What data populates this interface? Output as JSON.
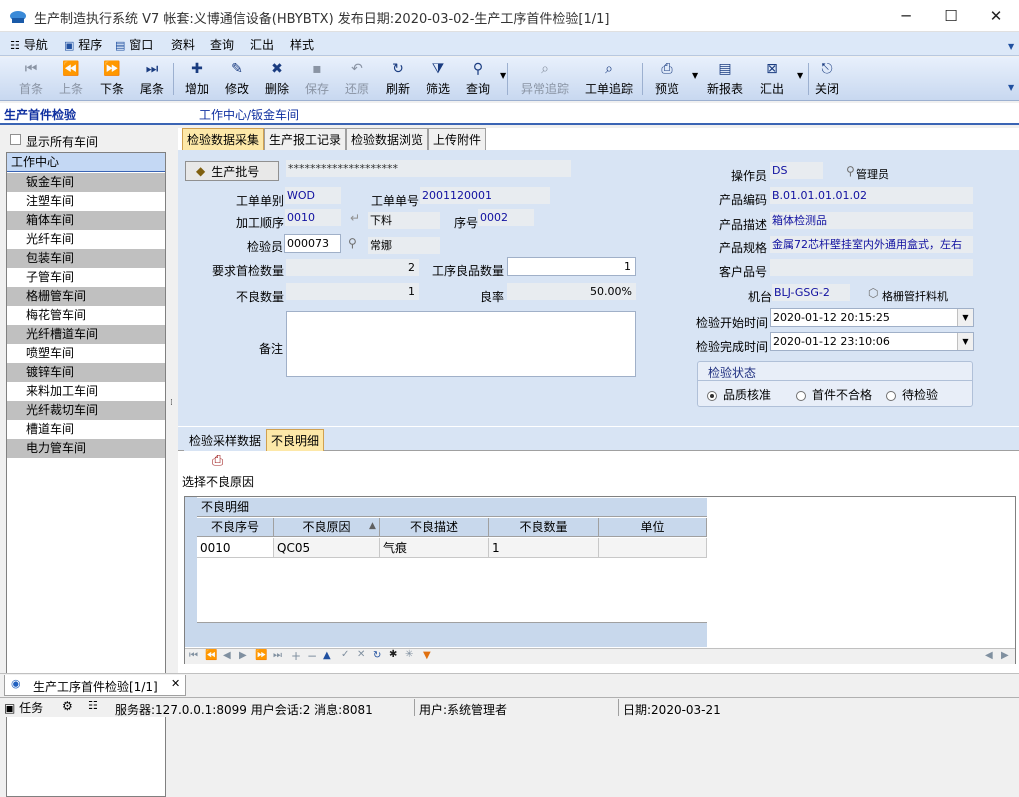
{
  "window": {
    "title": "生产制造执行系统 V7 帐套:义博通信设备(HBYBTX) 发布日期:2020-03-02-生产工序首件检验[1/1]"
  },
  "menu": [
    "导航",
    "程序",
    "窗口",
    "资料",
    "查询",
    "汇出",
    "样式"
  ],
  "toolbar": [
    {
      "label": "首条",
      "icon": "first-icon",
      "enabled": false
    },
    {
      "label": "上条",
      "icon": "prev-icon",
      "enabled": false
    },
    {
      "label": "下条",
      "icon": "next-icon",
      "enabled": true
    },
    {
      "label": "尾条",
      "icon": "last-icon",
      "enabled": true
    },
    {
      "label": "增加",
      "icon": "add-icon",
      "enabled": true
    },
    {
      "label": "修改",
      "icon": "edit-icon",
      "enabled": true
    },
    {
      "label": "删除",
      "icon": "delete-icon",
      "enabled": true
    },
    {
      "label": "保存",
      "icon": "save-icon",
      "enabled": false
    },
    {
      "label": "还原",
      "icon": "undo-icon",
      "enabled": false
    },
    {
      "label": "刷新",
      "icon": "refresh-icon",
      "enabled": true
    },
    {
      "label": "筛选",
      "icon": "filter-icon",
      "enabled": true
    },
    {
      "label": "查询",
      "icon": "query-icon",
      "enabled": true
    },
    {
      "label": "异常追踪",
      "icon": "trace-icon",
      "enabled": false
    },
    {
      "label": "工单追踪",
      "icon": "trace-icon",
      "enabled": true
    },
    {
      "label": "预览",
      "icon": "print-icon",
      "enabled": true
    },
    {
      "label": "新报表",
      "icon": "report-icon",
      "enabled": true
    },
    {
      "label": "汇出",
      "icon": "export-icon",
      "enabled": true
    },
    {
      "label": "关闭",
      "icon": "close-door-icon",
      "enabled": true
    }
  ],
  "module": {
    "title": "生产首件检验",
    "workcenter": "工作中心/钣金车间"
  },
  "left": {
    "show_all": "显示所有车间",
    "header": "工作中心",
    "items": [
      "钣金车间",
      "注塑车间",
      "箱体车间",
      "光纤车间",
      "包装车间",
      "子管车间",
      "格栅管车间",
      "梅花管车间",
      "光纤槽道车间",
      "喷塑车间",
      "镀锌车间",
      "来料加工车间",
      "光纤裁切车间",
      "槽道车间",
      "电力管车间"
    ]
  },
  "tabs": [
    "检验数据采集",
    "生产报工记录",
    "检验数据浏览",
    "上传附件"
  ],
  "form": {
    "batch_button": "生产批号",
    "batch_value": "********************",
    "wo_type_label": "工单单别",
    "wo_type": "WOD",
    "wo_no_label": "工单单号",
    "wo_no": "2001120001",
    "seq_label": "加工顺序",
    "seq": "0010",
    "proc_name": "下料",
    "serial_label": "序号",
    "serial": "0002",
    "inspector_label": "检验员",
    "inspector": "000073",
    "inspector_name": "常娜",
    "req_qty_label": "要求首检数量",
    "req_qty": "2",
    "good_qty_label": "工序良品数量",
    "good_qty": "1",
    "bad_qty_label": "不良数量",
    "bad_qty": "1",
    "yield_label": "良率",
    "yield": "50.00%",
    "remark_label": "备注",
    "operator_label": "操作员",
    "operator": "DS",
    "operator_name": "管理员",
    "prod_code_label": "产品编码",
    "prod_code": "B.01.01.01.01.02",
    "prod_desc_label": "产品描述",
    "prod_desc": "箱体检测品",
    "prod_spec_label": "产品规格",
    "prod_spec": "金属72芯杆壁挂室内外通用盒式，左右",
    "cust_no_label": "客户品号",
    "cust_no": "",
    "machine_label": "机台",
    "machine": "BLJ-GSG-2",
    "machine_name": "格栅管扦料机",
    "start_label": "检验开始时间",
    "start": "2020-01-12 20:15:25",
    "end_label": "检验完成时间",
    "end": "2020-01-12 23:10:06",
    "status_title": "检验状态",
    "status_options": [
      "品质核准",
      "首件不合格",
      "待检验"
    ],
    "status_selected": 0
  },
  "subtabs": [
    "检验采样数据",
    "不良明细"
  ],
  "select_reason": "选择不良原因",
  "grid": {
    "caption": "不良明细",
    "columns": [
      "不良序号",
      "不良原因",
      "不良描述",
      "不良数量",
      "单位"
    ],
    "rows": [
      [
        "0010",
        "QC05",
        "气痕",
        "1",
        ""
      ]
    ]
  },
  "bottom_tab": "生产工序首件检验[1/1]",
  "status": {
    "task": "任务",
    "server": "服务器:127.0.0.1:8099 用户会话:2 消息:8081",
    "user": "用户:系统管理者",
    "date": "日期:2020-03-21"
  }
}
